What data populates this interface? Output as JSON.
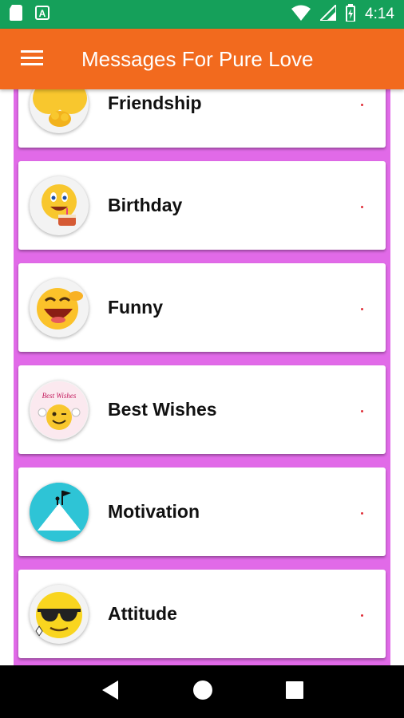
{
  "status_bar": {
    "time": "4:14",
    "icons": [
      "sd-card-icon",
      "a-notification-icon",
      "wifi-icon",
      "signal-icon",
      "battery-icon"
    ]
  },
  "app_bar": {
    "title": "Messages For Pure Love",
    "menu_icon": "hamburger-menu-icon"
  },
  "categories": [
    {
      "label": "Friendship",
      "icon": "friendship-emoji-icon"
    },
    {
      "label": "Birthday",
      "icon": "birthday-emoji-icon"
    },
    {
      "label": "Funny",
      "icon": "funny-emoji-icon"
    },
    {
      "label": "Best Wishes",
      "icon": "best-wishes-emoji-icon",
      "icon_text": "Best Wishes"
    },
    {
      "label": "Motivation",
      "icon": "motivation-mountain-icon"
    },
    {
      "label": "Attitude",
      "icon": "attitude-sunglasses-emoji-icon"
    }
  ],
  "nav_bar": {
    "buttons": [
      "back-icon",
      "home-icon",
      "recents-icon"
    ]
  },
  "colors": {
    "status_bar": "#15a05a",
    "app_bar": "#f26a1e",
    "list_background": "#e16ae8",
    "card": "#ffffff",
    "text": "#111111"
  }
}
